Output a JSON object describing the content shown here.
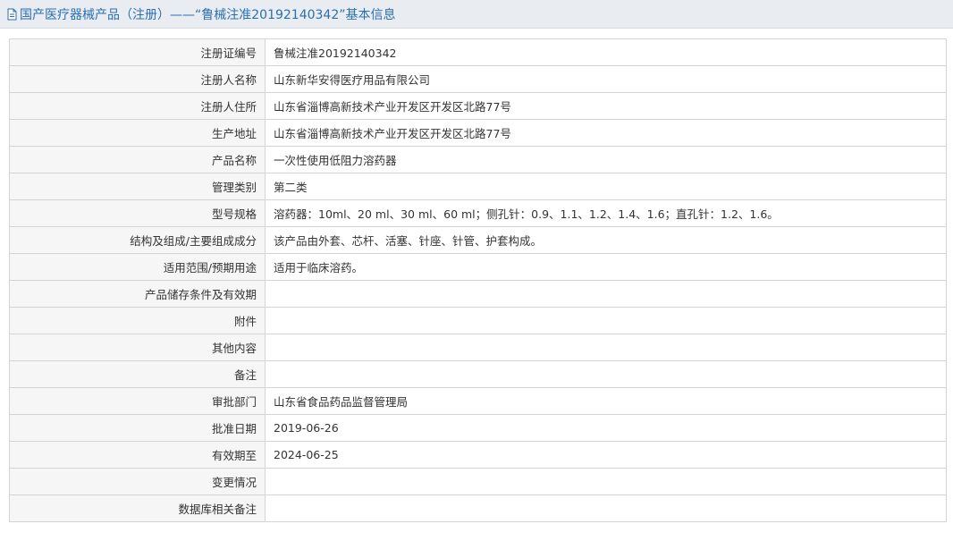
{
  "header": {
    "title": "国产医疗器械产品（注册）——“鲁械注准20192140342”基本信息",
    "icon": "document-icon"
  },
  "rows": [
    {
      "label": "注册证编号",
      "value": "鲁械注准20192140342"
    },
    {
      "label": "注册人名称",
      "value": "山东新华安得医疗用品有限公司"
    },
    {
      "label": "注册人住所",
      "value": "山东省淄博高新技术产业开发区开发区北路77号"
    },
    {
      "label": "生产地址",
      "value": "山东省淄博高新技术产业开发区开发区北路77号"
    },
    {
      "label": "产品名称",
      "value": "一次性使用低阻力溶药器"
    },
    {
      "label": "管理类别",
      "value": "第二类"
    },
    {
      "label": "型号规格",
      "value": "溶药器：10ml、20 ml、30 ml、60 ml；侧孔针：0.9、1.1、1.2、1.4、1.6；直孔针：1.2、1.6。"
    },
    {
      "label": "结构及组成/主要组成成分",
      "value": "该产品由外套、芯杆、活塞、针座、针管、护套构成。"
    },
    {
      "label": "适用范围/预期用途",
      "value": "适用于临床溶药。"
    },
    {
      "label": "产品储存条件及有效期",
      "value": ""
    },
    {
      "label": "附件",
      "value": ""
    },
    {
      "label": "其他内容",
      "value": ""
    },
    {
      "label": "备注",
      "value": ""
    },
    {
      "label": "审批部门",
      "value": "山东省食品药品监督管理局"
    },
    {
      "label": "批准日期",
      "value": "2019-06-26"
    },
    {
      "label": "有效期至",
      "value": "2024-06-25"
    },
    {
      "label": "变更情况",
      "value": ""
    },
    {
      "label": "数据库相关备注",
      "value": ""
    }
  ],
  "colors": {
    "title_text": "#2a6fb0",
    "title_bar_bg": "#e9edf2",
    "label_bg": "#f6f6f6",
    "border": "#d4d4d4"
  }
}
